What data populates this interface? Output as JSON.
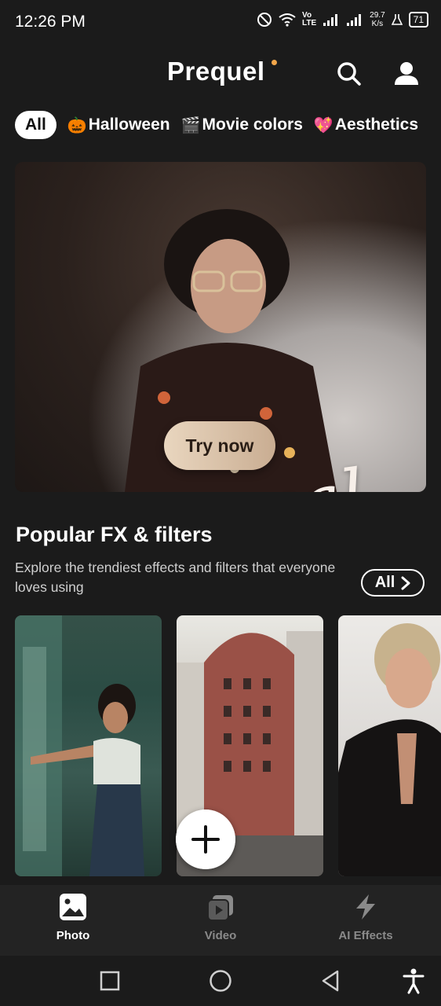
{
  "status": {
    "time": "12:26 PM",
    "network_label": "Vo\nLTE",
    "speed_value": "29.7",
    "speed_unit": "K/s",
    "battery": "71"
  },
  "header": {
    "logo": "Prequel",
    "logo_dot_color": "#f2a64a"
  },
  "chips": [
    {
      "label": "All",
      "emoji": "",
      "active": true
    },
    {
      "label": "Halloween",
      "emoji": "🎃",
      "active": false
    },
    {
      "label": "Movie colors",
      "emoji": "🎬",
      "active": false
    },
    {
      "label": "Aesthetics",
      "emoji": "💖",
      "active": false
    }
  ],
  "hero": {
    "word": "sensual",
    "button": "Try now"
  },
  "section": {
    "title": "Popular FX & filters",
    "subtitle": "Explore the trendiest effects and filters that everyone loves using",
    "all_label": "All"
  },
  "nav": [
    {
      "label": "Photo",
      "icon": "photo-icon",
      "active": true
    },
    {
      "label": "Video",
      "icon": "video-icon",
      "active": false
    },
    {
      "label": "AI Effects",
      "icon": "lightning-icon",
      "active": false
    }
  ],
  "colors": {
    "background": "#1b1b1b",
    "nav_active": "#ffffff",
    "nav_inactive": "#8a8a8a"
  }
}
